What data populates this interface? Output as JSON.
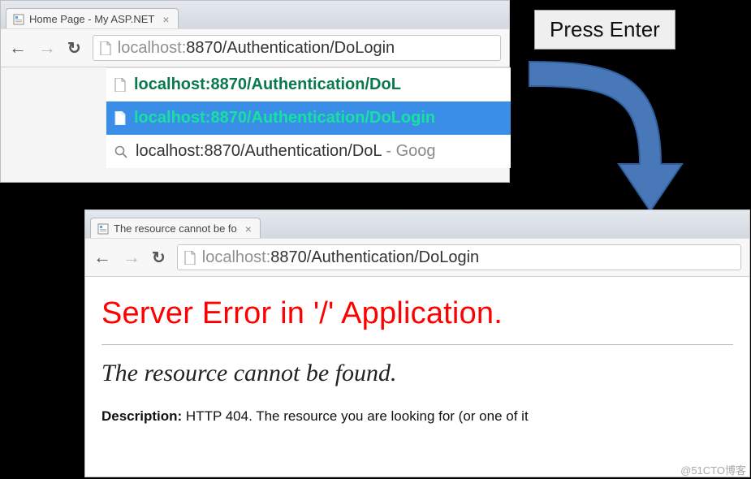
{
  "annotation": {
    "label": "Press Enter"
  },
  "browser1": {
    "tab_title": "Home Page - My ASP.NET",
    "url_host": "localhost:",
    "url_path": "8870/Authentication/DoLogin",
    "suggestions": [
      {
        "text": "localhost:8870/Authentication/DoL"
      },
      {
        "text": "localhost:8870/Authentication/DoLogin"
      },
      {
        "text": "localhost:8870/Authentication/DoL",
        "suffix": " - Goog"
      }
    ]
  },
  "browser2": {
    "tab_title": "The resource cannot be fo",
    "url_host": "localhost:",
    "url_path": "8870/Authentication/DoLogin",
    "error_heading": "Server Error in '/' Application.",
    "error_subheading": "The resource cannot be found.",
    "description_label": "Description:",
    "description_body": " HTTP 404. The resource you are looking for (or one of it"
  },
  "watermark": "@51CTO博客"
}
